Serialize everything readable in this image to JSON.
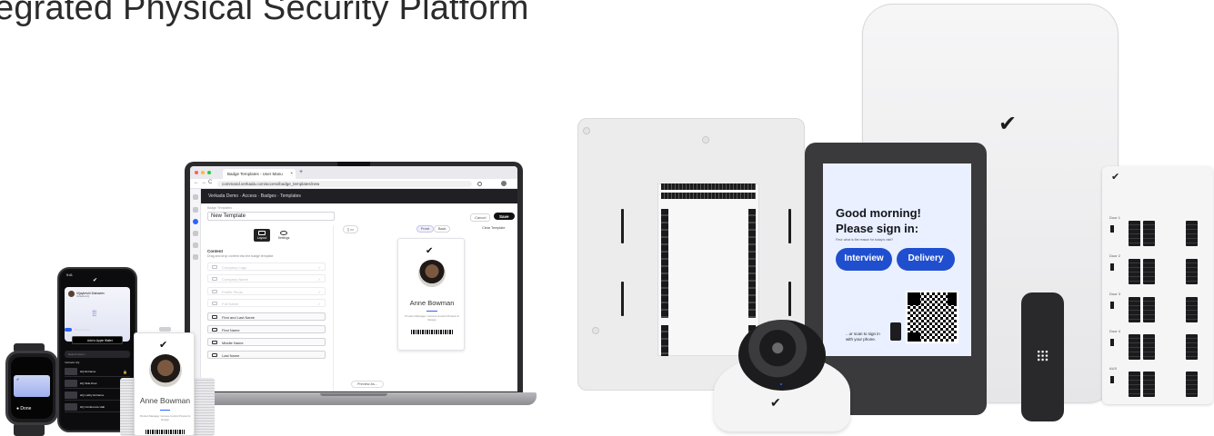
{
  "page": {
    "headline": "egrated Physical Security Platform"
  },
  "laptop": {
    "tab_title": "Badge Templates - User Manu",
    "tab_close": "×",
    "new_tab": "+",
    "url": "command.verkada.com/access/badge_templates/new",
    "nav": {
      "back": "←",
      "forward": "→",
      "reload": "C"
    },
    "topbar_text": "Verkada Demo · Access · Badges · Templates",
    "breadcrumb": "Badge Templates",
    "template_name": "New Template",
    "cancel": "Cancel",
    "save": "Save",
    "tabs": [
      {
        "label": "Layout"
      },
      {
        "label": "Settings"
      }
    ],
    "content_heading": "Content",
    "content_sub": "Drag and drop content into the badge template",
    "fields": [
      {
        "label": "Company Logo",
        "style": "ghost"
      },
      {
        "label": "Company Name",
        "style": "ghost"
      },
      {
        "label": "Profile Photo",
        "style": "ghost"
      },
      {
        "label": "Full Name",
        "style": "ghost"
      },
      {
        "label": "First and Last Name",
        "style": "solid"
      },
      {
        "label": "First Name",
        "style": "solid"
      },
      {
        "label": "Middle Name",
        "style": "solid"
      },
      {
        "label": "Last Name",
        "style": "solid"
      }
    ],
    "side_toggle": {
      "front": "Front",
      "back": "Back"
    },
    "clear_template": "Clear Template",
    "preview_badge": {
      "name": "Anne Bowman",
      "role": "Product Manager / Access Control Product & Design"
    },
    "preview_as": "Preview As..."
  },
  "phone": {
    "time": "9:41",
    "card_name": "Vijaykrishi Mahadev",
    "card_sub": "Verkada HQ",
    "toggle_label": "Bluetooth on",
    "wallet": "Add to Apple Wallet",
    "search_placeholder": "Search doors...",
    "group": "Verkada HQ",
    "doors": [
      "HQ Entrance",
      "HQ Side Door",
      "HQ Lobby Entrance",
      "HQ Conference Hall"
    ]
  },
  "watch": {
    "done": "Done"
  },
  "badge_card": {
    "name": "Anne Bowman",
    "role": "Product Manager / Access Control Product & Design"
  },
  "kiosk": {
    "greeting": "Good morning!\nPlease sign in:",
    "question": "First: what is the reason for today's visit?",
    "buttons": [
      "Interview",
      "Delivery"
    ],
    "scan": "...or scan to sign in\nwith your phone."
  },
  "controller": {
    "labels": [
      "Door 1",
      "Door 2",
      "Door 3",
      "Door 4",
      "AUX"
    ]
  },
  "colors": {
    "accent_blue": "#2b63ff",
    "kiosk_button": "#1f4fcf",
    "kiosk_screen": "#eaf0ff",
    "app_topbar": "#1f1f24",
    "device_dark": "#29292b"
  },
  "icons": [
    "verkada-logo-icon",
    "search-icon",
    "lock-icon",
    "phone-icon",
    "qr-code-icon"
  ]
}
